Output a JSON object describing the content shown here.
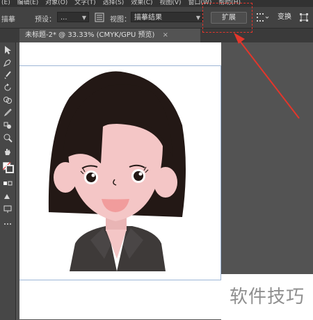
{
  "menu": {
    "items": [
      "(E)",
      "编辑(E)",
      "对象(O)",
      "文字(T)",
      "选择(S)",
      "效果(C)",
      "视图(V)",
      "窗口(W)",
      "帮助(H)"
    ]
  },
  "control_bar": {
    "left_label": "描摹",
    "preset_label": "预设：",
    "preset_value": "...",
    "view_label": "视图：",
    "view_value": "描摹结果",
    "expand_button": "扩展",
    "transform_button": "变换"
  },
  "document": {
    "tab_title": "未标题-2* @ 33.33% (CMYK/GPU 预览)",
    "close": "×"
  },
  "watermark": "软件技巧",
  "colors": {
    "hair": "#231815",
    "skin": "#f4c6c6",
    "mouth": "#f19c9c",
    "suit": "#3e3a39",
    "shirt": "#ffffff",
    "annotation": "#e3362b",
    "artboard_border": "#9db5d6"
  }
}
